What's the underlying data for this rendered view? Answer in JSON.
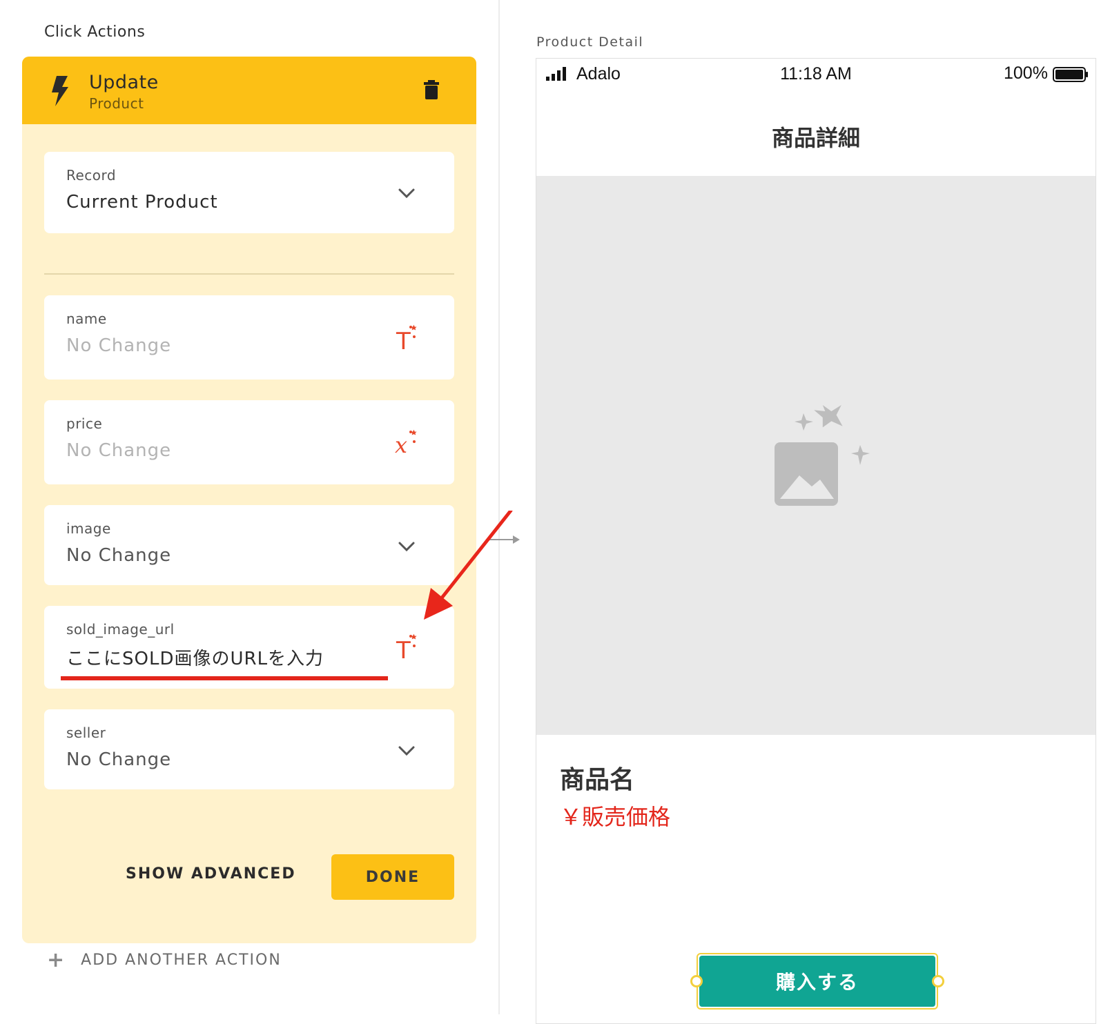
{
  "left_panel": {
    "section_title": "Click Actions",
    "action": {
      "title": "Update",
      "subtitle": "Product"
    },
    "record_field": {
      "label": "Record",
      "value": "Current Product"
    },
    "fields": [
      {
        "label": "name",
        "value": "No Change"
      },
      {
        "label": "price",
        "value": "No Change"
      },
      {
        "label": "image",
        "value": "No Change"
      },
      {
        "label": "sold_image_url",
        "value": "ここにSOLD画像のURLを入力"
      },
      {
        "label": "seller",
        "value": "No Change"
      }
    ],
    "show_advanced_label": "SHOW ADVANCED",
    "done_label": "DONE",
    "add_action_label": "ADD ANOTHER ACTION"
  },
  "right_panel": {
    "screen_label": "Product Detail",
    "status_bar": {
      "carrier": "Adalo",
      "time": "11:18 AM",
      "battery": "100%"
    },
    "nav_title": "商品詳細",
    "product_name": "商品名",
    "product_price": "￥販売価格",
    "buy_button_label": "購入する"
  },
  "colors": {
    "accent_yellow": "#fcc015",
    "panel_bg": "#fff2cc",
    "magic_red": "#e8492b",
    "highlight_red": "#e3261b",
    "buy_green": "#10a593"
  },
  "icons": {
    "action": "lightning-bolt-icon",
    "delete": "trash-icon",
    "dropdown": "chevron-down-icon",
    "magic_text": "magic-text-icon",
    "magic_number": "magic-number-icon",
    "add": "plus-icon",
    "image_placeholder": "image-placeholder-icon"
  }
}
